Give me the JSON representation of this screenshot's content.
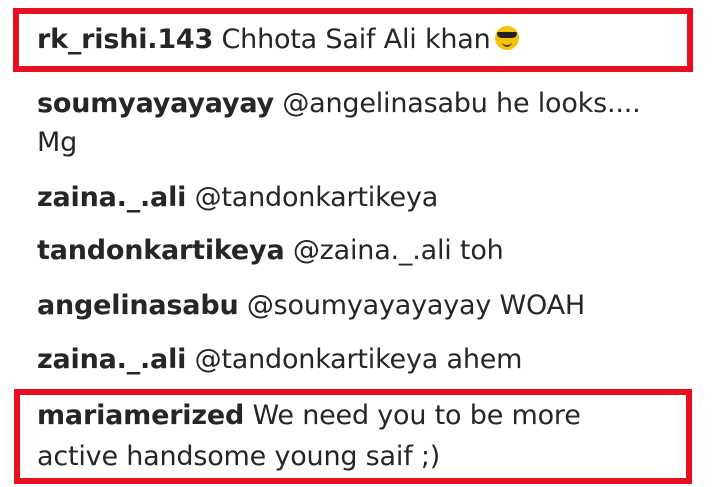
{
  "comments": [
    {
      "username": "rk_rishi.143",
      "text": "Chhota Saif Ali khan",
      "emoji": "sunglasses-emoji"
    },
    {
      "username": "soumyayayayay",
      "text": "@angelinasabu he looks....",
      "text_line2": "Mg"
    },
    {
      "username": "zaina._.ali",
      "text": "@tandonkartikeya"
    },
    {
      "username": "tandonkartikeya",
      "text": "@zaina._.ali toh"
    },
    {
      "username": "angelinasabu",
      "text": "@soumyayayayay WOAH"
    },
    {
      "username": "zaina._.ali",
      "text": "@tandonkartikeya ahem"
    },
    {
      "username": "mariamerized",
      "text": "We need you to be more",
      "text_line2": "active handsome young saif ;)"
    }
  ],
  "colors": {
    "highlight": "#e8101e",
    "text": "#262626",
    "background": "#ffffff"
  }
}
